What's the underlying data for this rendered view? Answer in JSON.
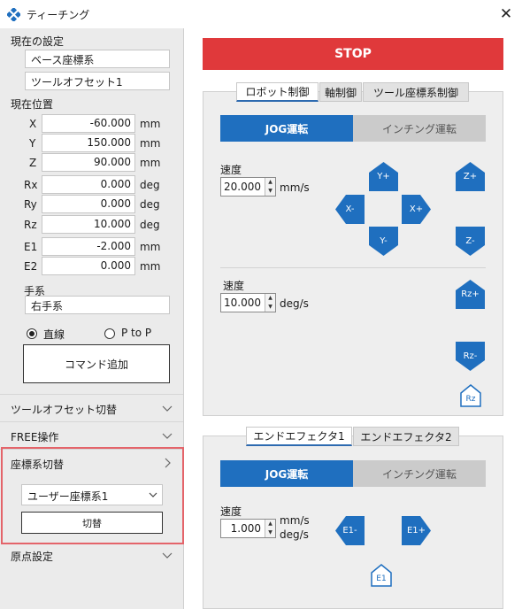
{
  "window": {
    "title": "ティーチング",
    "close_glyph": "✕"
  },
  "left": {
    "current_settings_label": "現在の設定",
    "coord_system": "ベース座標系",
    "tool_offset": "ツールオフセット1",
    "current_position_label": "現在位置",
    "positions": [
      {
        "axis": "X",
        "value": "-60.000",
        "unit": "mm"
      },
      {
        "axis": "Y",
        "value": "150.000",
        "unit": "mm"
      },
      {
        "axis": "Z",
        "value": "90.000",
        "unit": "mm"
      },
      {
        "axis": "Rx",
        "value": "0.000",
        "unit": "deg"
      },
      {
        "axis": "Ry",
        "value": "0.000",
        "unit": "deg"
      },
      {
        "axis": "Rz",
        "value": "10.000",
        "unit": "deg"
      },
      {
        "axis": "E1",
        "value": "-2.000",
        "unit": "mm"
      },
      {
        "axis": "E2",
        "value": "0.000",
        "unit": "mm"
      }
    ],
    "hand_system_label": "手系",
    "hand_system_value": "右手系",
    "radio_linear": "直線",
    "radio_ptp": "P to P",
    "add_command_label": "コマンド追加",
    "sections": {
      "tool_offset_switch": "ツールオフセット切替",
      "free_operation": "FREE操作",
      "coord_switch": "座標系切替",
      "origin_setting": "原点設定"
    },
    "coord_switch_select": "ユーザー座標系1",
    "switch_button": "切替"
  },
  "right": {
    "stop_label": "STOP",
    "robot_tabs": [
      "ロボット制御",
      "軸制御",
      "ツール座標系制御"
    ],
    "modes": [
      "JOG運転",
      "インチング運転"
    ],
    "speed_label": "速度",
    "linear_speed": "20.000",
    "linear_unit": "mm/s",
    "angular_speed": "10.000",
    "angular_unit": "deg/s",
    "jog_buttons": {
      "y_plus": "Y+",
      "y_minus": "Y-",
      "x_minus": "X-",
      "x_plus": "X+",
      "z_plus": "Z+",
      "z_minus": "Z-",
      "rz_plus": "Rz+",
      "rz_minus": "Rz-",
      "rz_home": "Rz"
    },
    "ee_tabs": [
      "エンドエフェクタ1",
      "エンドエフェクタ2"
    ],
    "ee_modes": [
      "JOG運転",
      "インチング運転"
    ],
    "ee_speed_label": "速度",
    "ee_speed": "1.000",
    "ee_unit_mm": "mm/s",
    "ee_unit_deg": "deg/s",
    "ee_buttons": {
      "minus": "E1-",
      "plus": "E1+",
      "home": "E1"
    }
  },
  "colors": {
    "accent": "#1f6fbf",
    "stop": "#e0393b",
    "highlight": "#e4646a"
  }
}
